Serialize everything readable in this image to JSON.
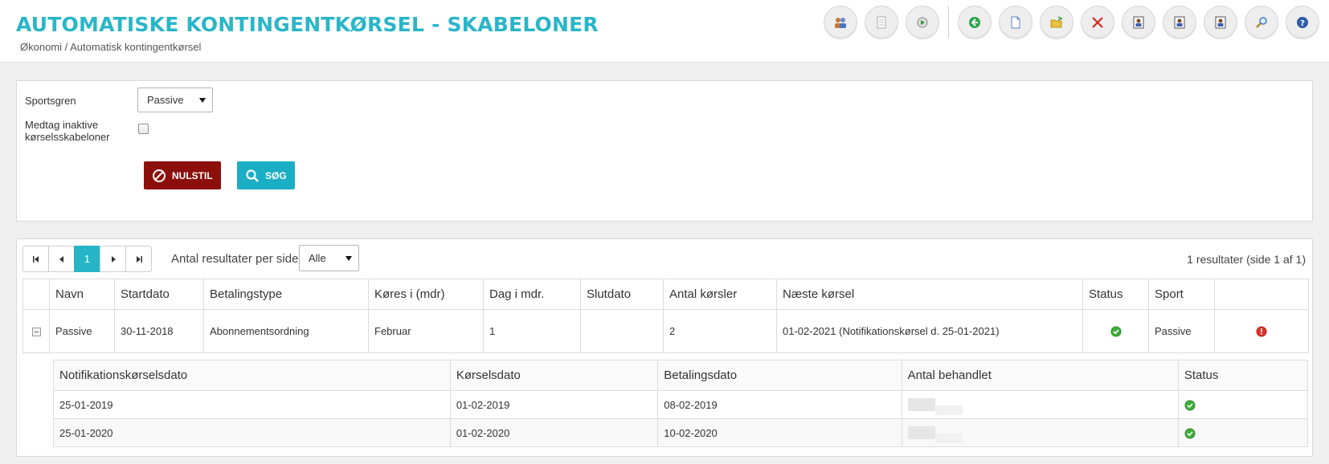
{
  "header": {
    "title": "AUTOMATISKE KONTINGENTKØRSEL - SKABELONER",
    "breadcrumb": "Økonomi / Automatisk kontingentkørsel"
  },
  "toolbar": {
    "buttons": [
      {
        "icon": "users-icon"
      },
      {
        "icon": "document-icon"
      },
      {
        "icon": "export-icon"
      },
      {
        "icon": "back-arrow-icon"
      },
      {
        "icon": "new-document-icon"
      },
      {
        "icon": "open-folder-icon"
      },
      {
        "icon": "delete-icon"
      },
      {
        "icon": "person-card-icon"
      },
      {
        "icon": "person-card-icon"
      },
      {
        "icon": "person-card-icon"
      },
      {
        "icon": "magnifier-icon"
      },
      {
        "icon": "help-icon"
      }
    ],
    "colors": {
      "back": "#2ea44f",
      "delete": "#d9261c",
      "help": "#2f5ea8"
    }
  },
  "filter": {
    "sport_label": "Sportsgren",
    "sport_value": "Passive",
    "include_inactive_label_1": "Medtag inaktive",
    "include_inactive_label_2": "kørselsskabeloner",
    "reset_label": "NULSTIL",
    "search_label": "SØG"
  },
  "results": {
    "pager": {
      "first": "first",
      "prev": "prev",
      "current": "1",
      "next": "next",
      "last": "last"
    },
    "per_page_label": "Antal resultater per side",
    "per_page_value": "Alle",
    "count_text": "1 resultater (side 1 af 1)",
    "columns": [
      "Navn",
      "Startdato",
      "Betalingstype",
      "Køres i (mdr)",
      "Dag i mdr.",
      "Slutdato",
      "Antal kørsler",
      "Næste kørsel",
      "Status",
      "Sport"
    ],
    "row": {
      "navn": "Passive",
      "startdato": "30-11-2018",
      "betalingstype": "Abonnementsordning",
      "koeres_i": "Februar",
      "dag": "1",
      "slutdato": "",
      "antal": "2",
      "naeste": "01-02-2021 (Notifikationskørsel d. 25-01-2021)",
      "sport": "Passive"
    },
    "sub_columns": [
      "Notifikationskørselsdato",
      "Kørselsdato",
      "Betalingsdato",
      "Antal behandlet",
      "Status"
    ],
    "sub_rows": [
      {
        "notif": "25-01-2019",
        "koersel": "01-02-2019",
        "betaling": "08-02-2019"
      },
      {
        "notif": "25-01-2020",
        "koersel": "01-02-2020",
        "betaling": "10-02-2020"
      }
    ],
    "colors": {
      "ok": "#3fae3a",
      "warning": "#e2312b",
      "accent": "#26b4c7"
    }
  }
}
